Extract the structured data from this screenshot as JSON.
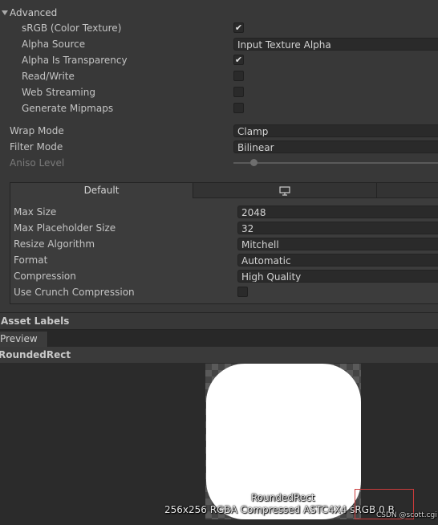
{
  "advanced": {
    "section_label": "Advanced",
    "srgb_label": "sRGB (Color Texture)",
    "srgb_checked": "✔",
    "alpha_source_label": "Alpha Source",
    "alpha_source_value": "Input Texture Alpha",
    "alpha_is_transparency_label": "Alpha Is Transparency",
    "alpha_is_transparency_checked": "✔",
    "read_write_label": "Read/Write",
    "web_streaming_label": "Web Streaming",
    "generate_mipmaps_label": "Generate Mipmaps"
  },
  "wrap_mode": {
    "label": "Wrap Mode",
    "value": "Clamp"
  },
  "filter_mode": {
    "label": "Filter Mode",
    "value": "Bilinear"
  },
  "aniso_level": {
    "label": "Aniso Level"
  },
  "platform": {
    "tabs": [
      {
        "label": "Default",
        "selected": true
      },
      {
        "icon": "monitor-icon"
      },
      {
        "label": ""
      }
    ],
    "max_size": {
      "label": "Max Size",
      "value": "2048"
    },
    "max_placeholder_size": {
      "label": "Max Placeholder Size",
      "value": "32"
    },
    "resize_algorithm": {
      "label": "Resize Algorithm",
      "value": "Mitchell"
    },
    "format": {
      "label": "Format",
      "value": "Automatic"
    },
    "compression": {
      "label": "Compression",
      "value": "High Quality"
    },
    "use_crunch": {
      "label": "Use Crunch Compression"
    }
  },
  "asset_labels": {
    "label": "Asset Labels"
  },
  "preview": {
    "tab_label": "Preview",
    "asset_name": "RoundedRect",
    "caption_name": "RoundedRect",
    "caption_info": "256x256  RGBA Compressed ASTC4X4 sRGB  0 B"
  },
  "watermark": "CSDN @scott.cgi",
  "colors": {
    "background": "#383838",
    "field": "#2a2a2a",
    "highlight_box": "#cc3b3b"
  }
}
